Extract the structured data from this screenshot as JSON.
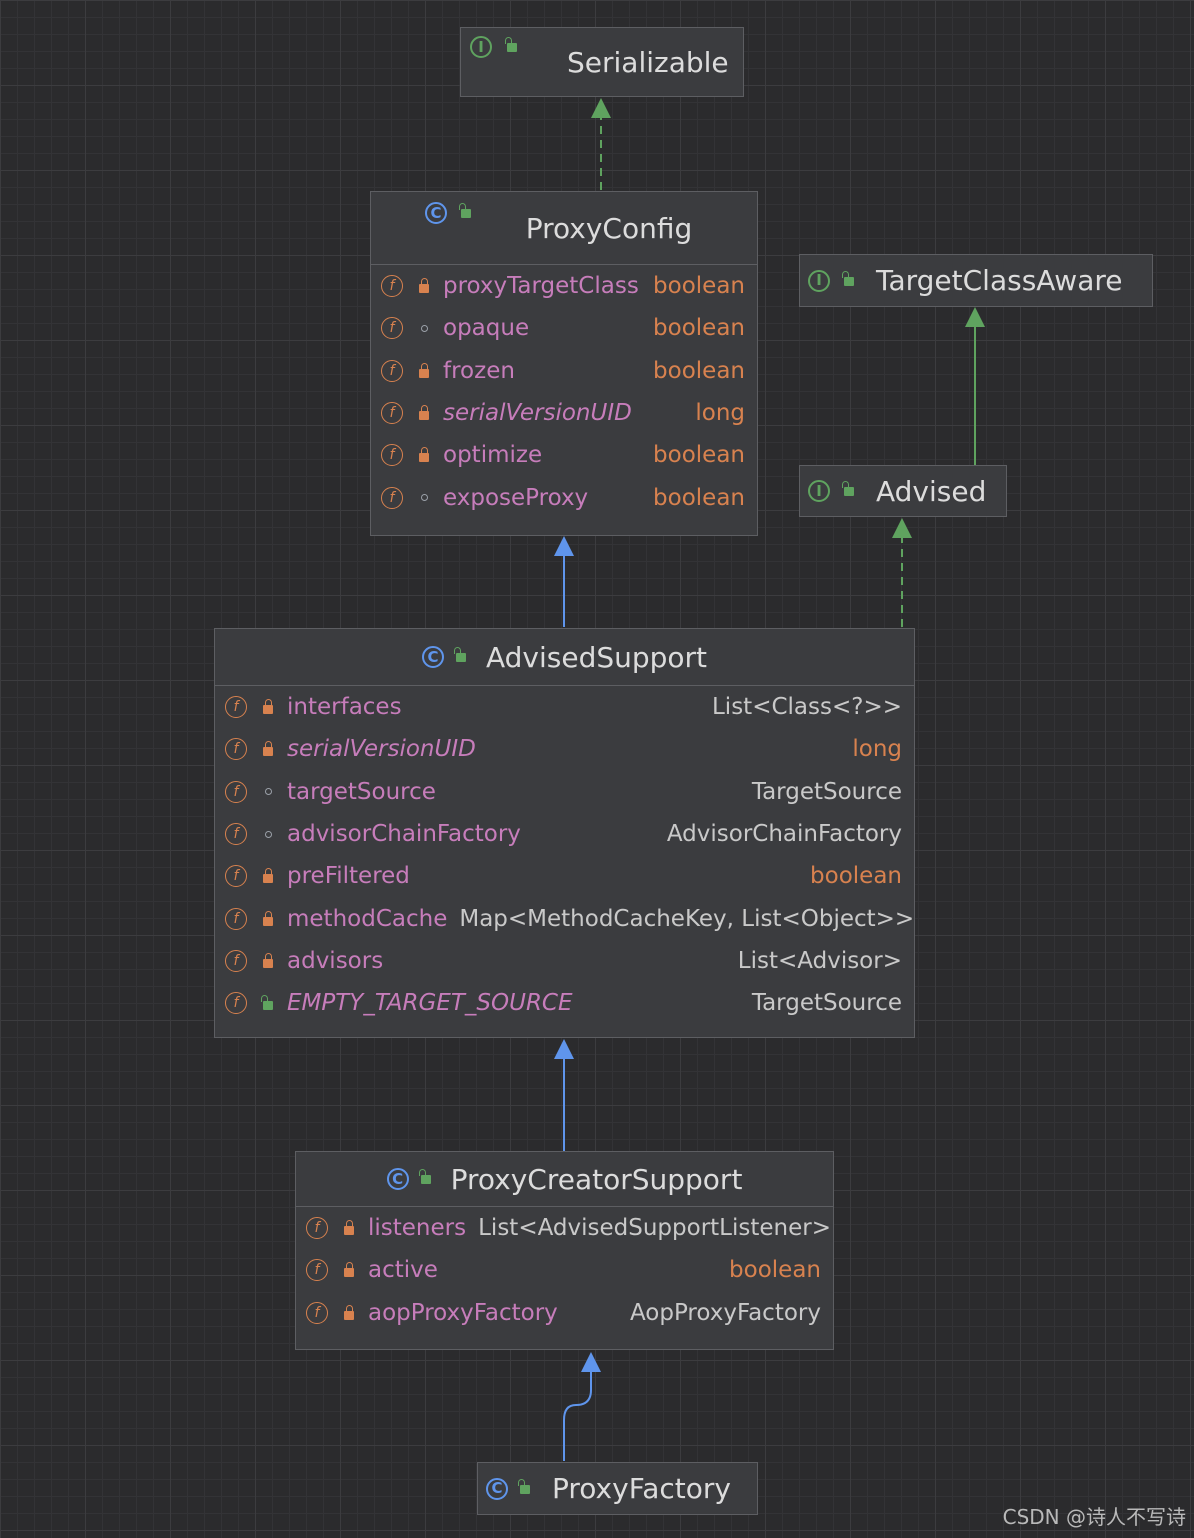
{
  "nodes": {
    "serializable": {
      "name": "Serializable",
      "kind": "interface"
    },
    "target_class_aware": {
      "name": "TargetClassAware",
      "kind": "interface"
    },
    "advised": {
      "name": "Advised",
      "kind": "interface"
    },
    "proxy_config": {
      "name": "ProxyConfig",
      "kind": "class",
      "fields": [
        {
          "name": "proxyTargetClass",
          "type": "boolean",
          "access": "private",
          "static": false,
          "primitive": true
        },
        {
          "name": "opaque",
          "type": "boolean",
          "access": "package",
          "static": false,
          "primitive": true
        },
        {
          "name": "frozen",
          "type": "boolean",
          "access": "private",
          "static": false,
          "primitive": true
        },
        {
          "name": "serialVersionUID",
          "type": "long",
          "access": "private",
          "static": true,
          "primitive": true
        },
        {
          "name": "optimize",
          "type": "boolean",
          "access": "private",
          "static": false,
          "primitive": true
        },
        {
          "name": "exposeProxy",
          "type": "boolean",
          "access": "package",
          "static": false,
          "primitive": true
        }
      ]
    },
    "advised_support": {
      "name": "AdvisedSupport",
      "kind": "class",
      "fields": [
        {
          "name": "interfaces",
          "type": "List<Class<?>>",
          "access": "private",
          "static": false,
          "primitive": false
        },
        {
          "name": "serialVersionUID",
          "type": "long",
          "access": "private",
          "static": true,
          "primitive": true
        },
        {
          "name": "targetSource",
          "type": "TargetSource",
          "access": "package",
          "static": false,
          "primitive": false
        },
        {
          "name": "advisorChainFactory",
          "type": "AdvisorChainFactory",
          "access": "package",
          "static": false,
          "primitive": false
        },
        {
          "name": "preFiltered",
          "type": "boolean",
          "access": "private",
          "static": false,
          "primitive": true
        },
        {
          "name": "methodCache",
          "type": "Map<MethodCacheKey, List<Object>>",
          "access": "private",
          "static": false,
          "primitive": false
        },
        {
          "name": "advisors",
          "type": "List<Advisor>",
          "access": "private",
          "static": false,
          "primitive": false
        },
        {
          "name": "EMPTY_TARGET_SOURCE",
          "type": "TargetSource",
          "access": "public",
          "static": true,
          "primitive": false
        }
      ]
    },
    "proxy_creator_support": {
      "name": "ProxyCreatorSupport",
      "kind": "class",
      "fields": [
        {
          "name": "listeners",
          "type": "List<AdvisedSupportListener>",
          "access": "private",
          "static": false,
          "primitive": false
        },
        {
          "name": "active",
          "type": "boolean",
          "access": "private",
          "static": false,
          "primitive": true
        },
        {
          "name": "aopProxyFactory",
          "type": "AopProxyFactory",
          "access": "private",
          "static": false,
          "primitive": false
        }
      ]
    },
    "proxy_factory": {
      "name": "ProxyFactory",
      "kind": "class"
    }
  },
  "relations": [
    {
      "from": "proxy_config",
      "to": "serializable",
      "type": "implements"
    },
    {
      "from": "advised",
      "to": "target_class_aware",
      "type": "extends"
    },
    {
      "from": "advised_support",
      "to": "proxy_config",
      "type": "extends"
    },
    {
      "from": "advised_support",
      "to": "advised",
      "type": "implements"
    },
    {
      "from": "proxy_creator_support",
      "to": "advised_support",
      "type": "extends"
    },
    {
      "from": "proxy_factory",
      "to": "proxy_creator_support",
      "type": "extends"
    }
  ],
  "colors": {
    "background": "#2b2b2d",
    "extends_edge": "#5f95ec",
    "implements_edge": "#5fa35f",
    "field_name": "#c77dbb",
    "primitive_type": "#d8824f",
    "type": "#c9c9c9"
  },
  "watermark": "CSDN @诗人不写诗"
}
